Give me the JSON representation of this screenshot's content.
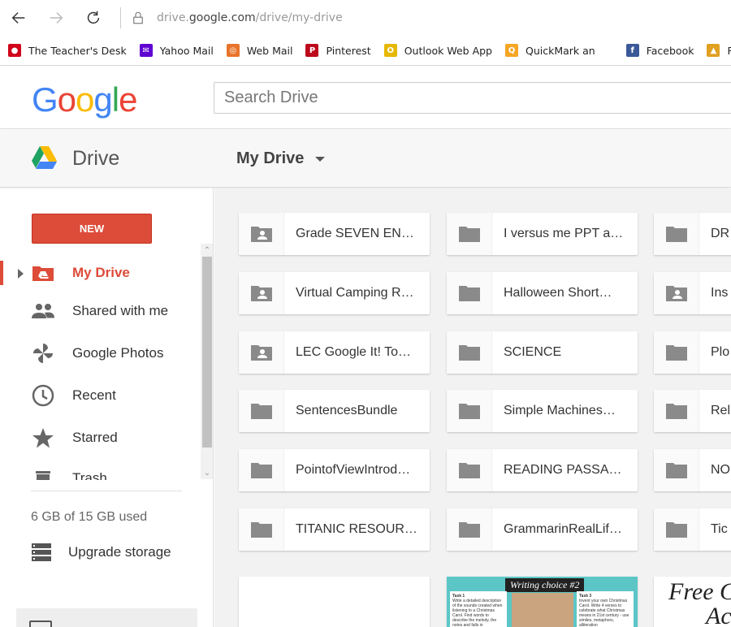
{
  "browser": {
    "url_prefix": "drive.",
    "url_domain": "google.com",
    "url_path": "/drive/my-drive",
    "bookmarks": [
      {
        "label": "The Teacher's Desk",
        "color": "#d0021b",
        "icon": "apple-icon"
      },
      {
        "label": "Yahoo Mail",
        "color": "#5f01d1",
        "icon": "envelope-icon"
      },
      {
        "label": "Web Mail",
        "color": "#e8742a",
        "icon": "webmail-icon"
      },
      {
        "label": "Pinterest",
        "color": "#bd081c",
        "icon": "pinterest-icon"
      },
      {
        "label": "Outlook Web App",
        "color": "#e6b800",
        "icon": "outlook-icon"
      },
      {
        "label": "QuickMark  an",
        "color": "#f5a623",
        "icon": "quickmark-icon"
      },
      {
        "label": "Facebook",
        "color": "#3b5998",
        "icon": "facebook-icon"
      },
      {
        "label": "Renweb",
        "color": "#e0a020",
        "icon": "renweb-icon"
      },
      {
        "label": "",
        "color": "#1a5fb4",
        "icon": "q-icon"
      }
    ]
  },
  "header": {
    "logo": "Google",
    "search_placeholder": "Search Drive"
  },
  "subheader": {
    "app_name": "Drive",
    "location": "My Drive"
  },
  "sidebar": {
    "new_label": "NEW",
    "items": [
      {
        "label": "My Drive",
        "icon": "my-drive-icon"
      },
      {
        "label": "Shared with me",
        "icon": "people-icon"
      },
      {
        "label": "Google Photos",
        "icon": "pinwheel-icon"
      },
      {
        "label": "Recent",
        "icon": "clock-icon"
      },
      {
        "label": "Starred",
        "icon": "star-icon"
      },
      {
        "label": "Trash",
        "icon": "trash-icon"
      }
    ],
    "storage": "6 GB of 15 GB used",
    "upgrade": "Upgrade storage"
  },
  "folders": [
    {
      "name": "Grade SEVEN EN…",
      "shared": true
    },
    {
      "name": "I versus me PPT a…",
      "shared": false
    },
    {
      "name": "DR",
      "shared": false
    },
    {
      "name": "Virtual Camping R…",
      "shared": true
    },
    {
      "name": "Halloween Short…",
      "shared": false
    },
    {
      "name": "Ins",
      "shared": true
    },
    {
      "name": "LEC Google It! To…",
      "shared": true
    },
    {
      "name": "SCIENCE",
      "shared": false
    },
    {
      "name": "Plo",
      "shared": false
    },
    {
      "name": "SentencesBundle",
      "shared": false
    },
    {
      "name": "Simple Machines…",
      "shared": false
    },
    {
      "name": "Rel",
      "shared": false
    },
    {
      "name": "PointofViewIntrod…",
      "shared": false
    },
    {
      "name": "READING PASSA…",
      "shared": false
    },
    {
      "name": "NO",
      "shared": false
    },
    {
      "name": "TITANIC RESOUR…",
      "shared": false
    },
    {
      "name": "GrammarinRealLif…",
      "shared": false
    },
    {
      "name": "Tic",
      "shared": false
    }
  ],
  "files": {
    "writing_title": "Writing choice #2",
    "writing_task1": "Task 1",
    "writing_task1_text": "Write a detailed description of the sounds created when listening to a Christmas Carol. Find words to describe the melody, the notes and falls in",
    "writing_task3": "Task 3",
    "writing_task3_text": "Invent your own Christmas Carol. Write 4 verses to celebrate what Christmas means in 21st century - use similes, metaphors, alliteration",
    "free_text": "Free C",
    "free_text2": "Ac"
  }
}
